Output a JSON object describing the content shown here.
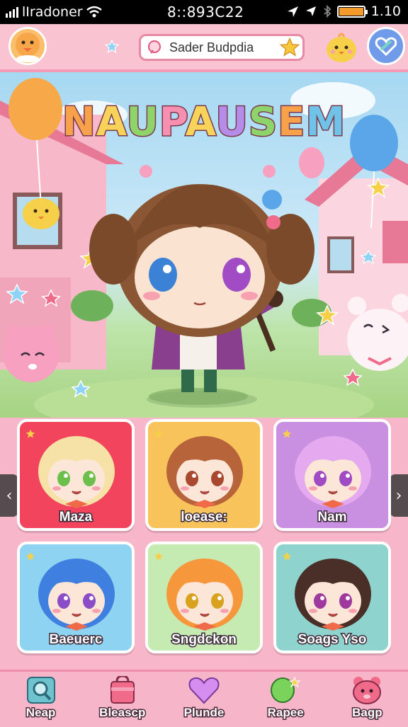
{
  "status_bar": {
    "carrier": "lIradoner",
    "time": "8::893C22",
    "battery": "1.10"
  },
  "header": {
    "search_value": "Sader Budpdia",
    "avatar_icon": "chick-face-icon",
    "mascot_icon": "chick-mascot-icon",
    "action_icon": "heart-ribbon-icon"
  },
  "game_title": [
    "N",
    "A",
    "U",
    "P",
    "A",
    "U",
    "S",
    "E",
    "M"
  ],
  "title_colors": [
    "#f7a24a",
    "#f7d35a",
    "#8fd36b",
    "#f78fb0",
    "#f7d35a",
    "#b58de8",
    "#8fd36b",
    "#f7a24a",
    "#6fc3e8"
  ],
  "characters": [
    {
      "name": "Maza",
      "card_color": "#f2445c",
      "hair": "#f6e2a6",
      "eyes": "#6cbf4a"
    },
    {
      "name": "loease:",
      "card_color": "#f7c35a",
      "hair": "#b7643a",
      "eyes": "#a8482f"
    },
    {
      "name": "Nam",
      "card_color": "#c98fe0",
      "hair": "#e4a9ef",
      "eyes": "#a04bc4"
    },
    {
      "name": "Baeuerc",
      "card_color": "#8fd3f2",
      "hair": "#3f7fe0",
      "eyes": "#8b4cc7"
    },
    {
      "name": "Sngdckon",
      "card_color": "#c5eab2",
      "hair": "#f7973b",
      "eyes": "#d9a21e"
    },
    {
      "name": "Soags Yso",
      "card_color": "#8fd3cf",
      "hair": "#4a2e28",
      "eyes": "#a0399e"
    }
  ],
  "tabs": [
    {
      "label": "Neap",
      "icon": "magnifier-icon"
    },
    {
      "label": "Bleascp",
      "icon": "shopping-bag-icon"
    },
    {
      "label": "Plunde",
      "icon": "heart-icon"
    },
    {
      "label": "Rapee",
      "icon": "balloon-icon"
    },
    {
      "label": "Bagp",
      "icon": "bear-face-icon"
    }
  ]
}
